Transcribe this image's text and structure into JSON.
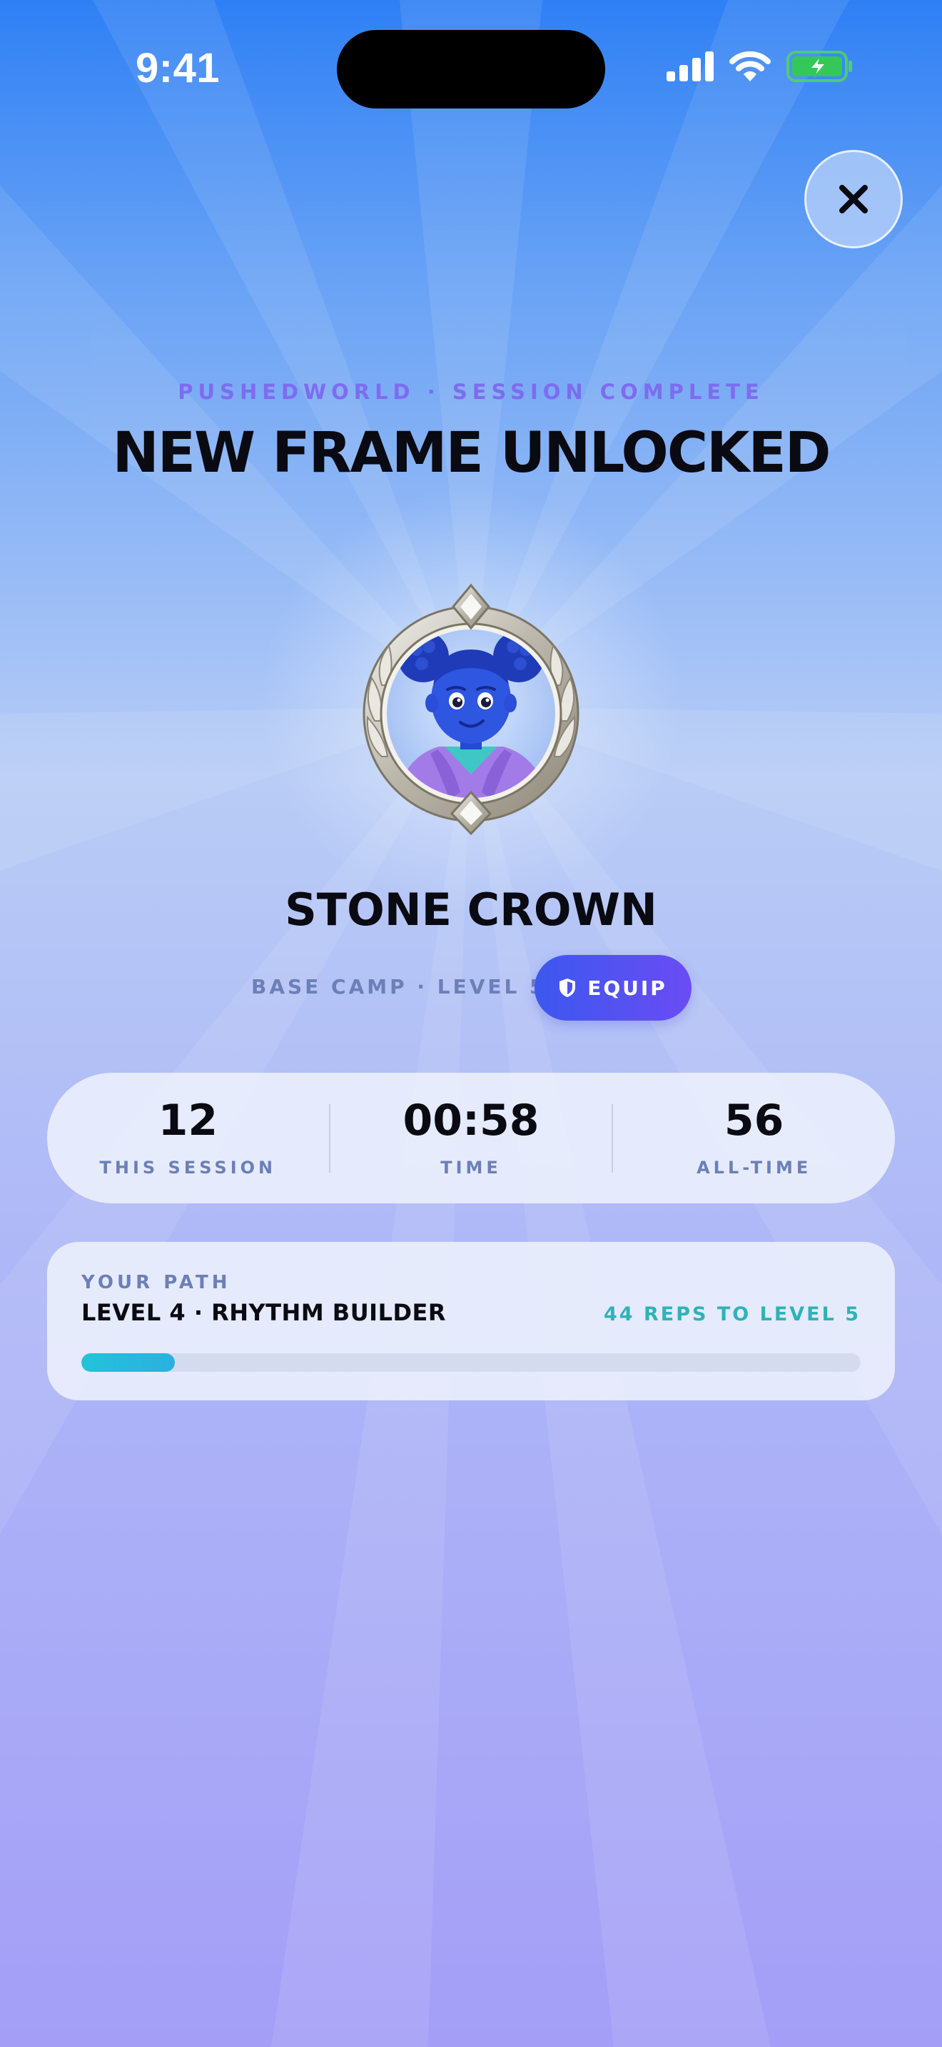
{
  "status_bar": {
    "time": "9:41"
  },
  "close_button": {
    "icon": "close-icon"
  },
  "header": {
    "eyebrow": "PUSHEDWORLD · SESSION COMPLETE",
    "title": "NEW FRAME UNLOCKED"
  },
  "reward": {
    "frame_name": "STONE CROWN",
    "meta": "BASE CAMP · LEVEL 5",
    "equip_label": "EQUIP",
    "equip_icon": "shield-icon"
  },
  "stats": [
    {
      "value": "12",
      "label": "THIS SESSION"
    },
    {
      "value": "00:58",
      "label": "TIME"
    },
    {
      "value": "56",
      "label": "ALL-TIME"
    }
  ],
  "path": {
    "eyebrow": "YOUR PATH",
    "title": "LEVEL 4 · RHYTHM BUILDER",
    "remaining": "44 REPS TO LEVEL 5",
    "progress_fraction": 0.12
  },
  "colors": {
    "accent_purple": "#7d6cf0",
    "equip_gradient_start": "#3c58ee",
    "equip_gradient_end": "#6a4cf5",
    "progress": "#22c3d9",
    "remaining_text": "#2db3b8",
    "battery_green": "#35c759"
  }
}
